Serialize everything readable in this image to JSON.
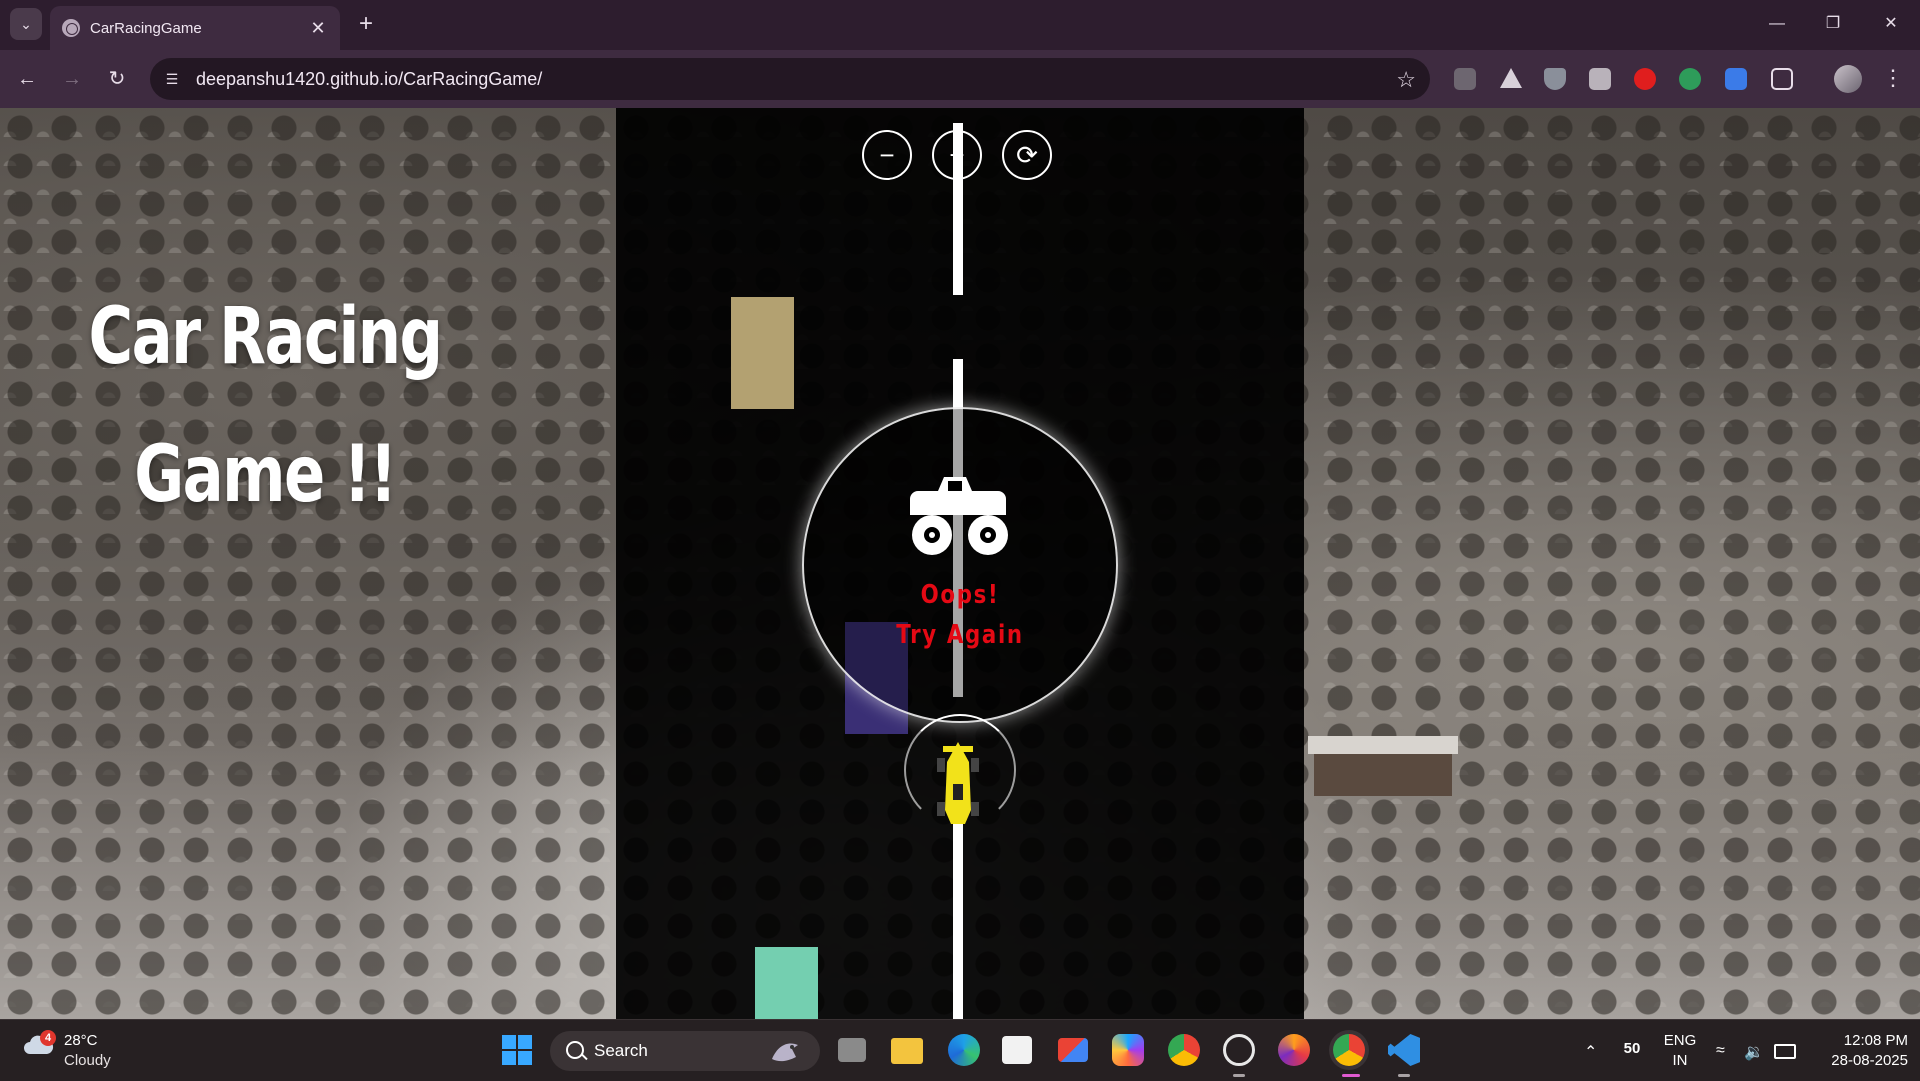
{
  "browser": {
    "tab_title": "CarRacingGame",
    "url": "deepanshu1420.github.io/CarRacingGame/"
  },
  "page": {
    "title_line1": "Car Racing",
    "title_line2": "Game !!"
  },
  "game": {
    "controls": {
      "minus_label": "−",
      "plus_label": "+",
      "restart_label": "⟳"
    },
    "game_over": {
      "line1": "Oops!",
      "line2": "Try Again"
    },
    "colors": {
      "road": "#000000",
      "lane": "#ffffff",
      "car_tan": "#b3a171",
      "car_purple": "#3a2f75",
      "car_mint": "#74cfb0",
      "player": "#f2e21a",
      "game_over_text": "#e50914"
    }
  },
  "taskbar": {
    "weather_badge": "4",
    "weather_temp": "28°C",
    "weather_desc": "Cloudy",
    "search_label": "Search",
    "tray_number": "50",
    "language_line1": "ENG",
    "language_line2": "IN",
    "time": "12:08 PM",
    "date": "28-08-2025"
  }
}
